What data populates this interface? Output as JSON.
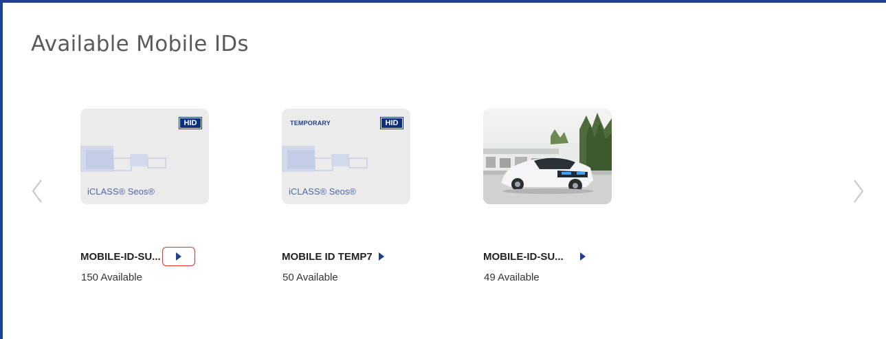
{
  "page": {
    "title": "Available Mobile IDs"
  },
  "carousel": {
    "prev_icon": "chevron-left-icon",
    "next_icon": "chevron-right-icon",
    "cards": [
      {
        "name": "MOBILE-ID-SU...",
        "availability": "150 Available",
        "thumbnail": "hid-card",
        "logo_text": "HID",
        "temp_label": "",
        "brand_text": "iCLASS® Seos®",
        "action_icon": "play-arrow-icon",
        "focused": true
      },
      {
        "name": "MOBILE ID TEMP7",
        "availability": "50 Available",
        "thumbnail": "hid-card-temporary",
        "logo_text": "HID",
        "temp_label": "TEMPORARY",
        "brand_text": "iCLASS® Seos®",
        "action_icon": "play-arrow-icon",
        "focused": false
      },
      {
        "name": "MOBILE-ID-SU...",
        "availability": "49 Available",
        "thumbnail": "car-photo",
        "action_icon": "play-arrow-icon",
        "focused": false
      }
    ]
  },
  "colors": {
    "frame_border": "#1f3f8f",
    "accent": "#1f3f8f",
    "focus_ring": "#e03030"
  }
}
